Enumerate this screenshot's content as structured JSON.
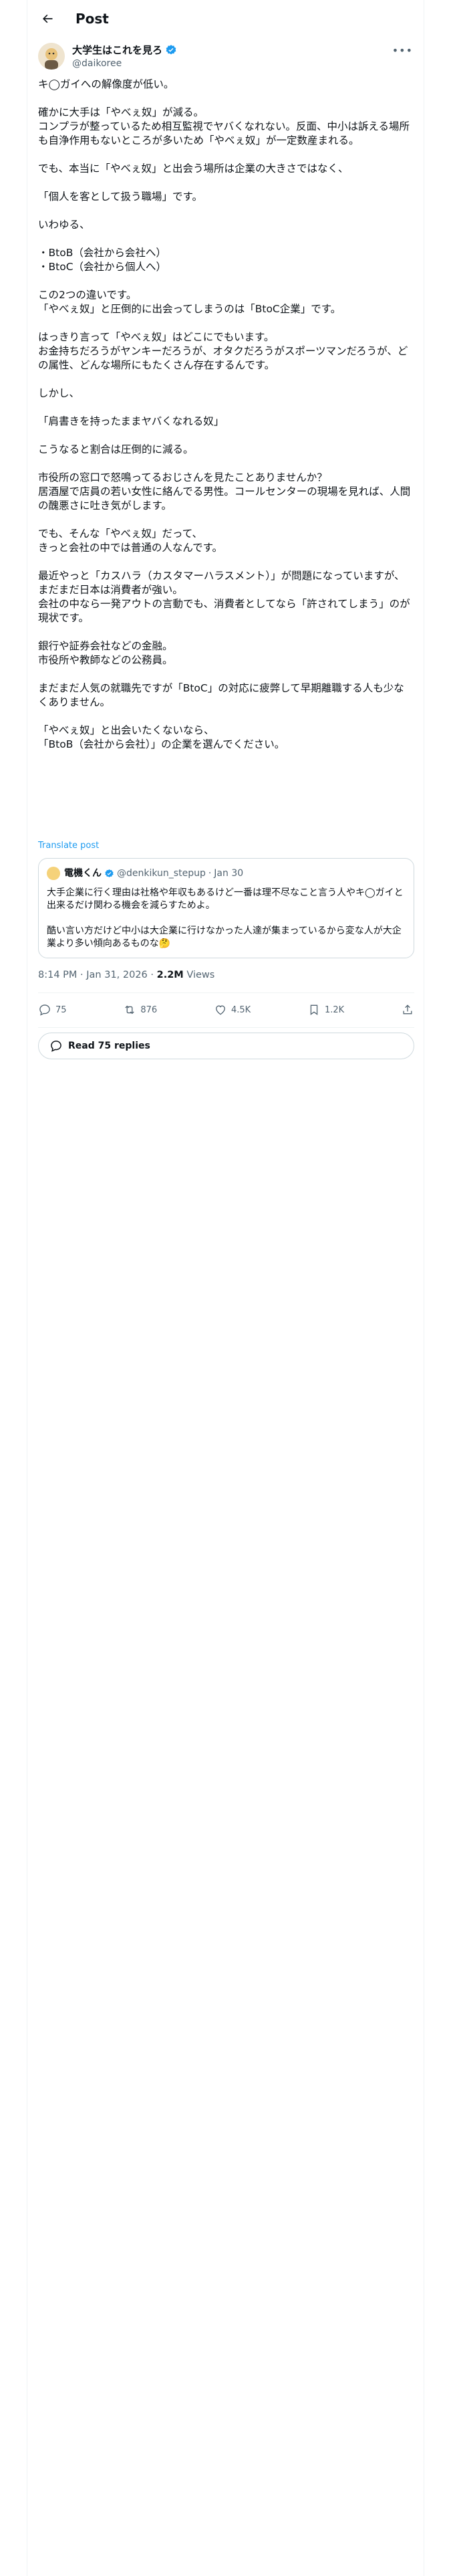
{
  "header": {
    "title": "Post"
  },
  "author": {
    "name": "大学生はこれを見ろ",
    "handle": "@daikoree"
  },
  "post": {
    "lines": [
      "キ◯ガイへの解像度が低い。",
      "",
      "確かに大手は「やべぇ奴」が減る。",
      "コンプラが整っているため相互監視でヤバくなれない。反面、中小は訴える場所も自浄作用もないところが多いため「やべぇ奴」が一定数産まれる。",
      "",
      "でも、本当に「やべぇ奴」と出会う場所は企業の大きさではなく、",
      "",
      "「個人を客として扱う職場」です。",
      "",
      "いわゆる、",
      "",
      "・BtoB（会社から会社へ）",
      "・BtoC（会社から個人へ）",
      "",
      "この2つの違いです。",
      "「やべぇ奴」と圧倒的に出会ってしまうのは「BtoC企業」です。",
      "",
      "はっきり言って「やべぇ奴」はどこにでもいます。",
      "お金持ちだろうがヤンキーだろうが、オタクだろうがスポーツマンだろうが、どの属性、どんな場所にもたくさん存在するんです。",
      "",
      "しかし、",
      "",
      "「肩書きを持ったままヤバくなれる奴」",
      "",
      "こうなると割合は圧倒的に減る。",
      "",
      "市役所の窓口で怒鳴ってるおじさんを見たことありませんか？",
      "居酒屋で店員の若い女性に絡んでる男性。コールセンターの現場を見れば、人間の醜悪さに吐き気がします。",
      "",
      "でも、そんな「やべぇ奴」だって、",
      "きっと会社の中では普通の人なんです。",
      "",
      "最近やっと「カスハラ（カスタマーハラスメント）」が問題になっていますが、まだまだ日本は消費者が強い。",
      "会社の中なら一発アウトの言動でも、消費者としてなら「許されてしまう」のが現状です。",
      "",
      "銀行や証券会社などの金融。",
      "市役所や教師などの公務員。",
      "",
      "まだまだ人気の就職先ですが「BtoC」の対応に疲弊して早期離職する人も少なくありません。",
      "",
      "「やべぇ奴」と出会いたくないなら、",
      "「BtoB（会社から会社）」の企業を選んでください。"
    ],
    "translate_label": "Translate post",
    "time": "8:14 PM · Jan 31, 2026",
    "views_count": "2.2M",
    "views_label": "Views"
  },
  "quote": {
    "name": "電機くん",
    "handle": "@denkikun_stepup",
    "date": "Jan 30",
    "lines": [
      "大手企業に行く理由は社格や年収もあるけど一番は理不尽なこと言う人やキ◯ガイと出来るだけ関わる機会を減らすためよ。",
      "",
      "酷い言い方だけど中小は大企業に行けなかった人達が集まっているから変な人が大企業より多い傾向あるものな🤔"
    ]
  },
  "actions": {
    "replies": "75",
    "reposts": "876",
    "likes": "4.5K",
    "bookmarks": "1.2K"
  },
  "read_replies_label": "Read 75 replies",
  "colors": {
    "accent": "#1d9bf0",
    "muted": "#536471",
    "text": "#0f1419",
    "border": "#cfd9de"
  }
}
